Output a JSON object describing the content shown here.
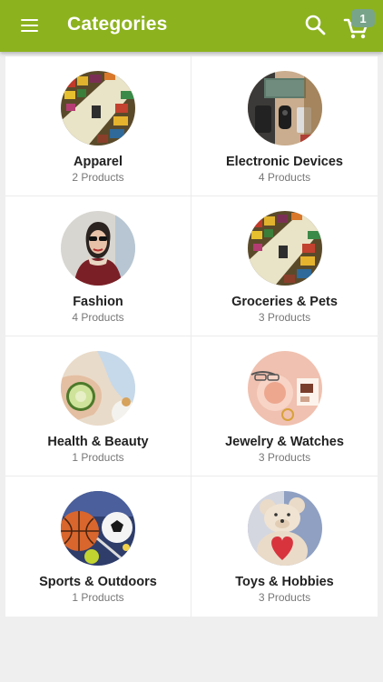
{
  "app": {
    "title": "Categories",
    "cart_count": "1",
    "colors": {
      "primary": "#8cb21e",
      "badge": "#78a48a"
    }
  },
  "categories": [
    {
      "name": "Apparel",
      "count": "2 Products",
      "image": "market-shelves-photo"
    },
    {
      "name": "Electronic Devices",
      "count": "4 Products",
      "image": "gadgets-flatlay-photo"
    },
    {
      "name": "Fashion",
      "count": "4 Products",
      "image": "woman-sunglasses-photo"
    },
    {
      "name": "Groceries & Pets",
      "count": "3 Products",
      "image": "market-shelves-photo"
    },
    {
      "name": "Health & Beauty",
      "count": "1 Products",
      "image": "spa-cucumber-photo"
    },
    {
      "name": "Jewelry & Watches",
      "count": "3 Products",
      "image": "jewelry-flatlay-photo"
    },
    {
      "name": "Sports & Outdoors",
      "count": "1 Products",
      "image": "sports-balls-photo"
    },
    {
      "name": "Toys & Hobbies",
      "count": "3 Products",
      "image": "teddy-bear-photo"
    }
  ]
}
